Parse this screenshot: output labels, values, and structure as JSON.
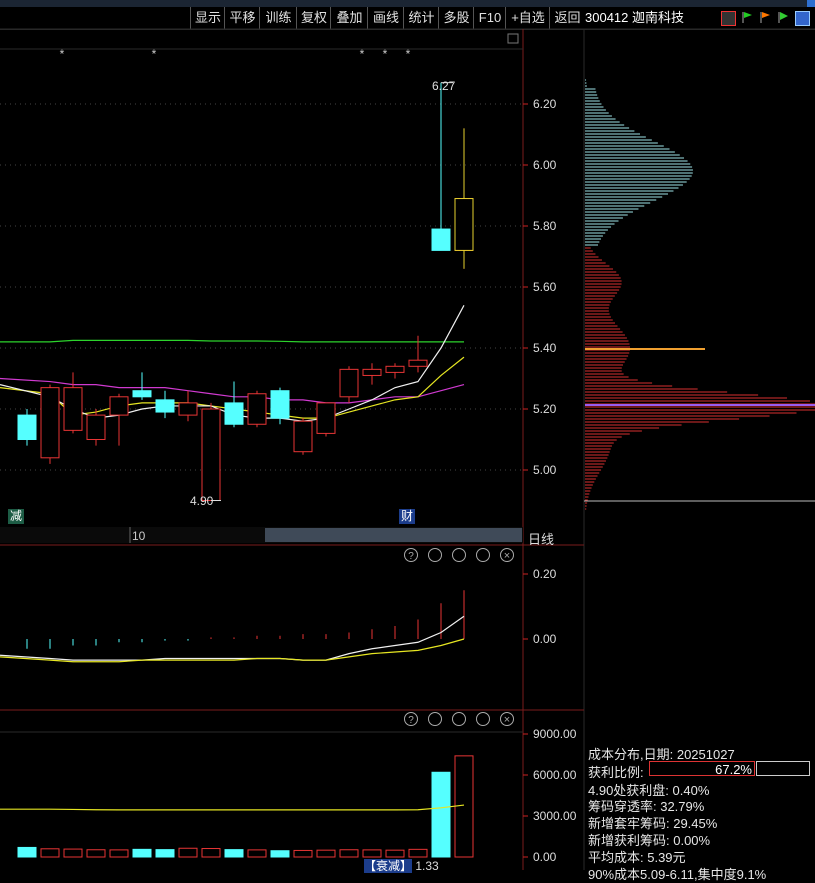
{
  "toolbar": {
    "buttons": [
      "显示",
      "平移",
      "训练",
      "复权",
      "叠加",
      "画线",
      "统计",
      "多股",
      "F10",
      "+自选",
      "返回"
    ]
  },
  "stock": {
    "code": "300412",
    "name": "迦南科技"
  },
  "icons": [
    "quote-icon",
    "flag-green-icon",
    "flag-orange-icon",
    "flag-green2-icon",
    "image-icon"
  ],
  "main_chart": {
    "y_ticks": [
      "6.20",
      "6.00",
      "5.80",
      "5.60",
      "5.40",
      "5.20",
      "5.00"
    ],
    "high_label": "6.27",
    "low_label": "4.90",
    "x_label": "10",
    "period_label": "日线",
    "markers": {
      "reduce": "减",
      "finance": "财"
    },
    "star": "*"
  },
  "indicator1": {
    "y_ticks": [
      "0.20",
      "0.00"
    ]
  },
  "indicator2": {
    "y_ticks": [
      "9000.00",
      "6000.00",
      "3000.00",
      "0.00"
    ],
    "tag": "【衰减】",
    "value": "1.33"
  },
  "panel_tools": [
    "help-icon",
    "zoom-icon",
    "settings-icon",
    "switch-icon",
    "close-icon"
  ],
  "chip": {
    "title": "成本分布,日期: 20251027",
    "profit_label": "获利比例:",
    "profit_value": "67.2%",
    "profit_fraction": 0.672,
    "lines": [
      "4.90处获利盘: 0.40%",
      "筹码穿透率: 32.79%",
      "新增套牢筹码: 29.45%",
      "新增获利筹码: 0.00%",
      "平均成本: 5.39元",
      "90%成本5.09-6.11,集中度9.1%"
    ]
  },
  "chart_data": {
    "type": "candlestick",
    "ylim": [
      4.85,
      6.3
    ],
    "candles": [
      {
        "o": 5.18,
        "c": 5.1,
        "h": 5.2,
        "l": 5.08
      },
      {
        "o": 5.04,
        "c": 5.27,
        "h": 5.28,
        "l": 5.02
      },
      {
        "o": 5.13,
        "c": 5.27,
        "h": 5.32,
        "l": 5.12
      },
      {
        "o": 5.1,
        "c": 5.18,
        "h": 5.2,
        "l": 5.08
      },
      {
        "o": 5.18,
        "c": 5.24,
        "h": 5.25,
        "l": 5.08
      },
      {
        "o": 5.26,
        "c": 5.24,
        "h": 5.32,
        "l": 5.23
      },
      {
        "o": 5.23,
        "c": 5.19,
        "h": 5.26,
        "l": 5.17
      },
      {
        "o": 5.18,
        "c": 5.22,
        "h": 5.26,
        "l": 5.16
      },
      {
        "o": 4.9,
        "c": 5.2,
        "h": 5.22,
        "l": 4.9
      },
      {
        "o": 5.22,
        "c": 5.15,
        "h": 5.29,
        "l": 5.14
      },
      {
        "o": 5.15,
        "c": 5.25,
        "h": 5.26,
        "l": 5.14
      },
      {
        "o": 5.26,
        "c": 5.17,
        "h": 5.27,
        "l": 5.15
      },
      {
        "o": 5.06,
        "c": 5.16,
        "h": 5.17,
        "l": 5.05
      },
      {
        "o": 5.12,
        "c": 5.22,
        "h": 5.22,
        "l": 5.11
      },
      {
        "o": 5.24,
        "c": 5.33,
        "h": 5.34,
        "l": 5.22
      },
      {
        "o": 5.31,
        "c": 5.33,
        "h": 5.35,
        "l": 5.28
      },
      {
        "o": 5.32,
        "c": 5.34,
        "h": 5.35,
        "l": 5.3
      },
      {
        "o": 5.34,
        "c": 5.36,
        "h": 5.44,
        "l": 5.32
      },
      {
        "o": 5.79,
        "c": 5.72,
        "h": 6.27,
        "l": 5.72
      },
      {
        "o": 5.72,
        "c": 5.89,
        "h": 6.12,
        "l": 5.66
      }
    ],
    "ma_green": [
      5.42,
      5.42,
      5.425,
      5.425,
      5.425,
      5.425,
      5.425,
      5.425,
      5.423,
      5.423,
      5.423,
      5.422,
      5.42,
      5.42,
      5.42,
      5.42,
      5.42,
      5.42,
      5.42,
      5.42
    ],
    "ma_magenta": [
      5.3,
      5.29,
      5.28,
      5.28,
      5.27,
      5.27,
      5.27,
      5.26,
      5.25,
      5.24,
      5.24,
      5.23,
      5.23,
      5.22,
      5.22,
      5.23,
      5.24,
      5.24,
      5.26,
      5.28
    ],
    "ma_yellow": [
      5.27,
      5.25,
      5.18,
      5.19,
      5.21,
      5.22,
      5.22,
      5.22,
      5.21,
      5.2,
      5.19,
      5.18,
      5.17,
      5.17,
      5.19,
      5.21,
      5.23,
      5.24,
      5.31,
      5.37
    ],
    "ma_white": [
      5.28,
      5.24,
      5.2,
      5.17,
      5.18,
      5.2,
      5.21,
      5.21,
      5.21,
      5.18,
      5.17,
      5.17,
      5.16,
      5.17,
      5.2,
      5.23,
      5.27,
      5.29,
      5.4,
      5.54
    ],
    "indicator1": {
      "ylim": [
        -0.2,
        0.25
      ],
      "bars": [
        -0.03,
        -0.03,
        -0.02,
        -0.02,
        -0.01,
        -0.01,
        -0.005,
        -0.005,
        0.005,
        0.005,
        0.01,
        0.01,
        0.015,
        0.015,
        0.02,
        0.03,
        0.04,
        0.06,
        0.11,
        0.15
      ],
      "line_white": [
        -0.05,
        -0.06,
        -0.065,
        -0.065,
        -0.065,
        -0.065,
        -0.06,
        -0.06,
        -0.06,
        -0.06,
        -0.06,
        -0.06,
        -0.065,
        -0.065,
        -0.045,
        -0.03,
        -0.02,
        -0.01,
        0.02,
        0.07
      ],
      "line_yellow": [
        -0.055,
        -0.065,
        -0.07,
        -0.07,
        -0.07,
        -0.065,
        -0.065,
        -0.065,
        -0.065,
        -0.065,
        -0.06,
        -0.06,
        -0.065,
        -0.065,
        -0.055,
        -0.045,
        -0.04,
        -0.035,
        -0.02,
        0.0
      ]
    },
    "volume": {
      "ylim": [
        0,
        9800
      ],
      "values": [
        700,
        600,
        580,
        530,
        520,
        560,
        540,
        640,
        620,
        540,
        520,
        460,
        480,
        500,
        530,
        520,
        500,
        560,
        6200,
        7400
      ],
      "ma_yellow": [
        3500,
        3500,
        3480,
        3460,
        3450,
        3450,
        3450,
        3450,
        3450,
        3450,
        3450,
        3450,
        3450,
        3450,
        3450,
        3450,
        3450,
        3460,
        3600,
        3800
      ]
    }
  }
}
